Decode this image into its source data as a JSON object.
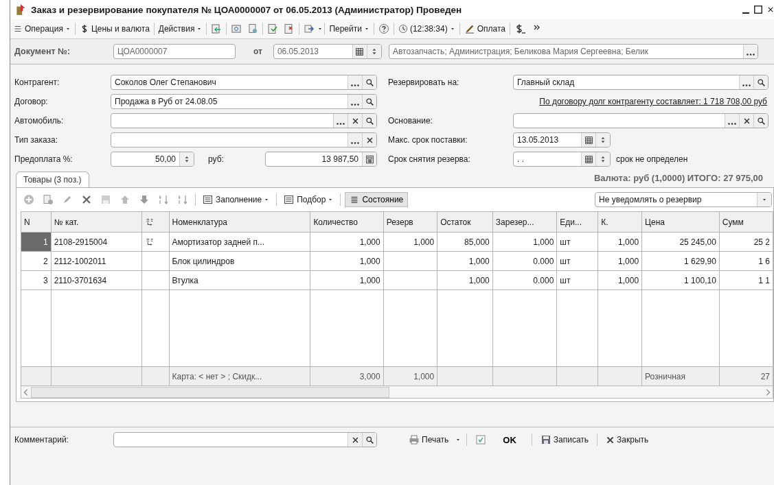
{
  "window": {
    "title": "Заказ и резервирование покупателя № ЦОА0000007 от 06.05.2013 (Администратор) Проведен"
  },
  "toolbar": [
    {
      "label": "Операция",
      "dropdown": true
    },
    {
      "label": "Цены и валюта",
      "dropdown": false
    },
    {
      "label": "Действия",
      "dropdown": true
    },
    {
      "label": "Перейти",
      "dropdown": true
    },
    {
      "label": "(12:38:34)",
      "dropdown": true
    },
    {
      "label": "Оплата",
      "dropdown": false
    }
  ],
  "header": {
    "doc_label": "Документ №:",
    "doc_number": "ЦОА0000007",
    "date_label": "от",
    "date": "06.05.2013",
    "responsible": "Автозапчасть; Администрация; Беликова Мария Сергеевна; Белик"
  },
  "left_fields": [
    {
      "kind": "field",
      "label": "Контрагент:",
      "value": "Соколов Олег Степанович",
      "clear": false,
      "search": true
    },
    {
      "kind": "field",
      "label": "Договор:",
      "value": "Продажа в Руб от 24.08.05",
      "clear": false,
      "search": true
    },
    {
      "kind": "field",
      "label": "Автомобиль:",
      "clear": true,
      "search": true
    },
    {
      "kind": "field",
      "label": "Тип заказа:",
      "clear": true,
      "search": false
    },
    {
      "kind": "prepay",
      "label": "Предоплата %:",
      "value": "50,00",
      "currency_label": "руб:",
      "amount": "13 987,50"
    }
  ],
  "right_fields": [
    {
      "kind": "field",
      "label": "Резервировать на:",
      "value": "Главный склад",
      "clear": false,
      "search": true
    },
    {
      "kind": "link",
      "text": "По договору долг контрагенту составляет: 1 718 708,00 руб"
    },
    {
      "kind": "field",
      "label": "Основание:",
      "clear": true,
      "search": true
    },
    {
      "kind": "date",
      "label": "Макс. срок поставки:",
      "value": "13.05.2013"
    },
    {
      "kind": "date",
      "label": "Срок снятия резерва:",
      "value": ". .",
      "note": "срок не определен"
    }
  ],
  "totals": "Валюта: руб (1,0000) ИТОГО: 27 975,00",
  "tabs": [
    {
      "label": "Товары (3 поз.)",
      "selected": true
    }
  ],
  "table_toolbar": {
    "fill": "Заполнение",
    "pick": "Подбор",
    "state": "Состояние",
    "notify": "Не уведомлять о резервир"
  },
  "table": {
    "columns": [
      "N",
      "№ кат.",
      "",
      "Номенклатура",
      "Количество",
      "Резерв",
      "Остаток",
      "Зарезер...",
      "Еди...",
      "К.",
      "Цена",
      "Сумм"
    ],
    "rows": [
      {
        "selected": true,
        "analog": true,
        "cells": [
          "1",
          "2108-2915004",
          "",
          "Амортизатор задней п...",
          "1,000",
          "1,000",
          "85,000",
          "1,000",
          "шт",
          "1,000",
          "25 245,00",
          "25 2"
        ]
      },
      {
        "selected": false,
        "analog": false,
        "cells": [
          "2",
          "2112-1002011",
          "",
          "Блок цилиндров",
          "1,000",
          "",
          "1,000",
          "0.000",
          "шт",
          "1,000",
          "1 629,90",
          "1 6"
        ]
      },
      {
        "selected": false,
        "analog": false,
        "cells": [
          "3",
          "2110-3701634",
          "",
          "Втулка",
          "1,000",
          "",
          "1,000",
          "0.000",
          "шт",
          "1,000",
          "1 100,10",
          "1 1"
        ]
      }
    ],
    "footer": {
      "nomenclature": "Карта: < нет > ; Скидк...",
      "quantity": "3,000",
      "reserve": "1,000",
      "price": "Розничная",
      "sum": "27"
    }
  },
  "bottom": {
    "comment_label": "Комментарий:",
    "print": "Печать",
    "ok": "OK",
    "save": "Записать",
    "close": "Закрыть"
  }
}
